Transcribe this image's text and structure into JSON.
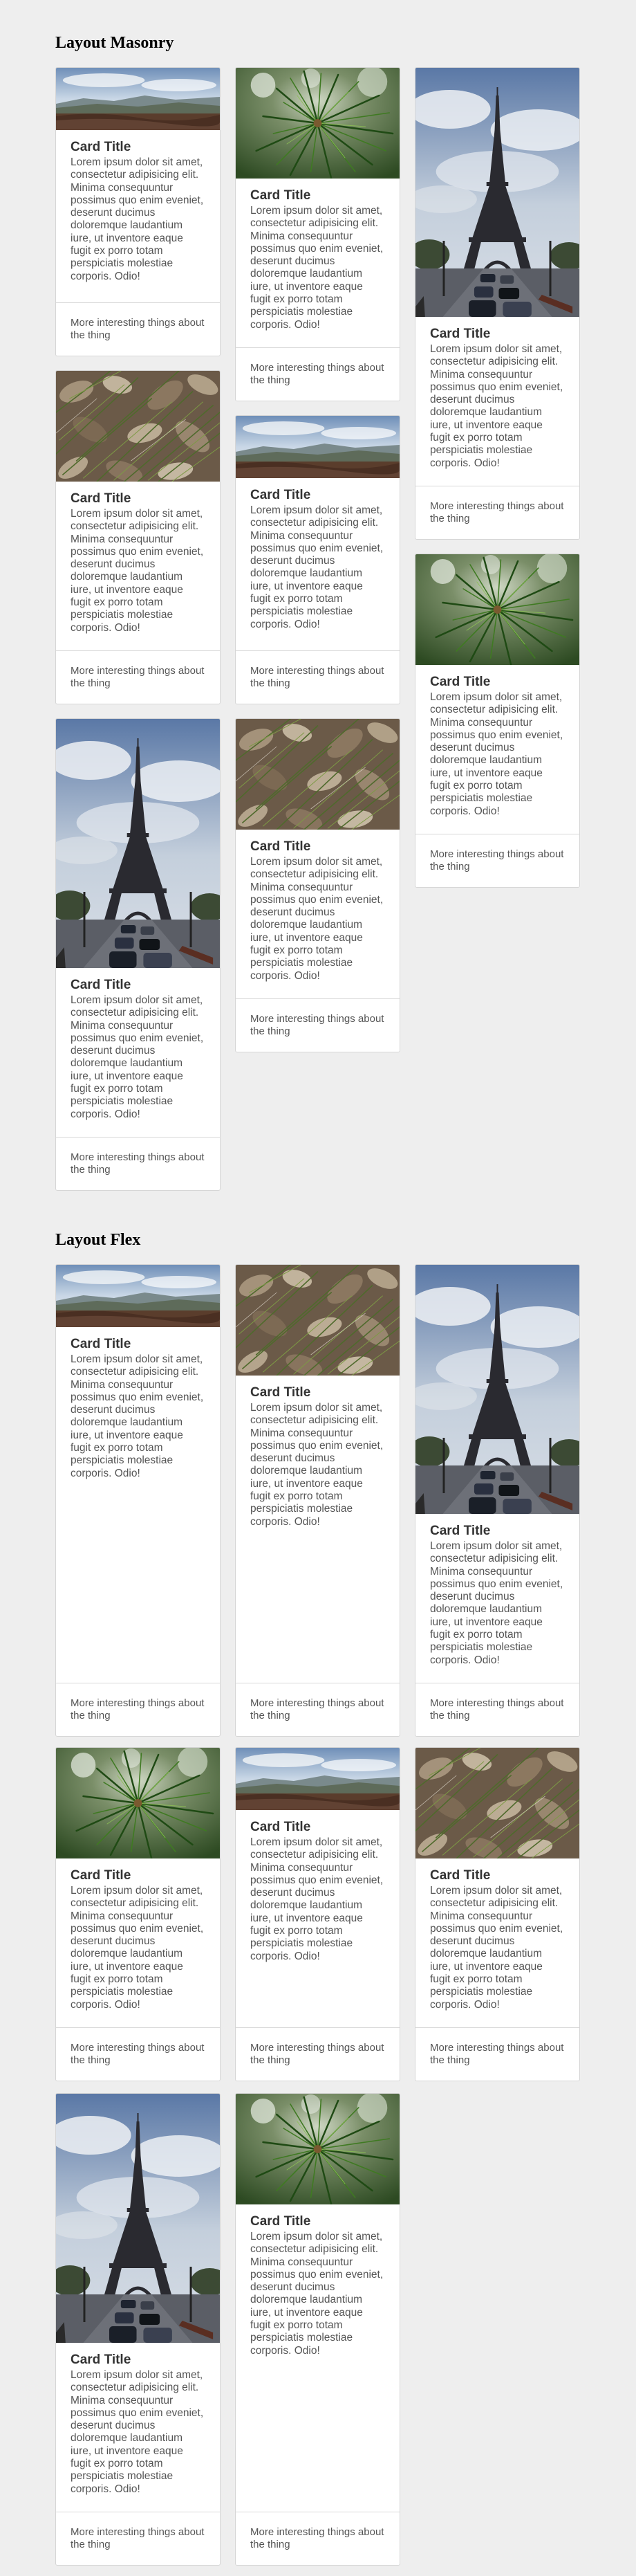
{
  "sections": {
    "masonry_title": "Layout Masonry",
    "flex_title": "Layout Flex"
  },
  "card": {
    "title": "Card Title",
    "text": "Lorem ipsum dolor sit amet, consectetur adipisicing elit. Minima consequuntur possimus quo enim eveniet, deserunt ducimus doloremque laudantium iure, ut inventore eaque fugit ex porro totam perspiciatis molestiae corporis. Odio!",
    "footer": "More interesting things about the thing"
  },
  "images": {
    "landscape": "landscape-photo",
    "pine": "pine-branch-photo",
    "eiffel": "eiffel-tower-photo",
    "leaves": "pine-needles-leaves-photo"
  }
}
